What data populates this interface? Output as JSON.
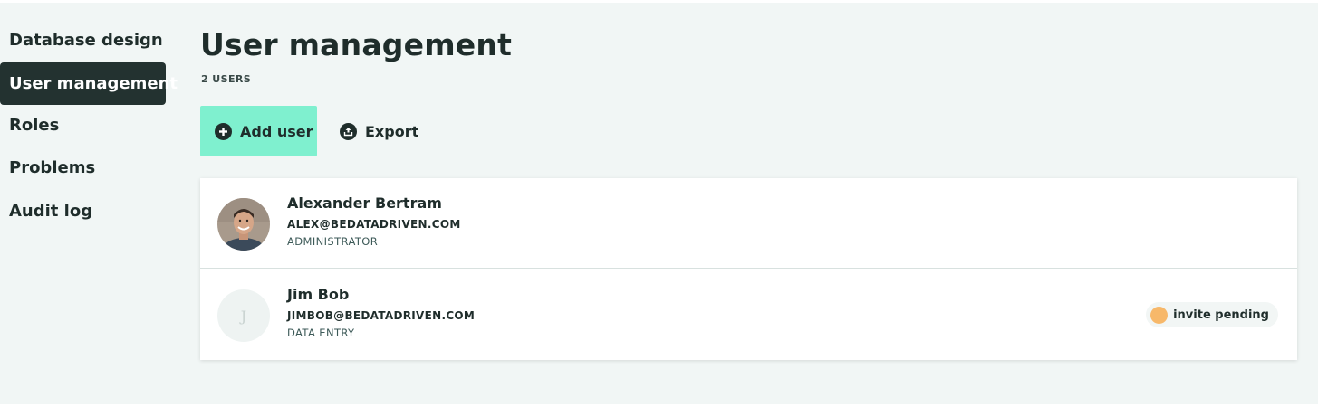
{
  "sidebar": {
    "items": [
      {
        "label": "Database design",
        "active": false
      },
      {
        "label": "User management",
        "active": true
      },
      {
        "label": "Roles",
        "active": false
      },
      {
        "label": "Problems",
        "active": false
      },
      {
        "label": "Audit log",
        "active": false
      }
    ]
  },
  "main": {
    "title": "User management",
    "user_count": "2 USERS",
    "actions": {
      "add_label": "Add user",
      "export_label": "Export",
      "add_icon": "plus-circle-icon",
      "export_icon": "export-icon"
    },
    "users": [
      {
        "name": "Alexander Bertram",
        "email": "ALEX@BEDATADRIVEN.COM",
        "role": "ADMINISTRATOR",
        "avatar": "photo",
        "status": ""
      },
      {
        "name": "Jim Bob",
        "email": "JIMBOB@BEDATADRIVEN.COM",
        "role": "DATA ENTRY",
        "avatar_initial": "J",
        "status": "invite pending"
      }
    ]
  },
  "colors": {
    "accent": "#7ff0cf",
    "sidebar_active": "#233230",
    "background": "#f1f6f5",
    "pending": "#f7b86a"
  }
}
